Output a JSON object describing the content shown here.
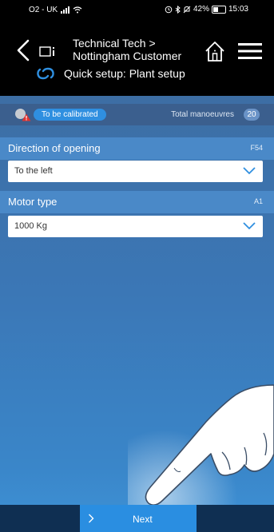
{
  "status": {
    "carrier": "O2 - UK",
    "battery": "42%",
    "time": "15:03"
  },
  "header": {
    "breadcrumb_line1": "Technical Tech >",
    "breadcrumb_line2": "Nottingham Customer",
    "setup_title": "Quick setup: Plant setup"
  },
  "calibration": {
    "status_label": "To be calibrated",
    "total_label": "Total manoeuvres",
    "total_value": "20"
  },
  "fields": {
    "direction": {
      "label": "Direction of opening",
      "code": "F54",
      "value": "To the left"
    },
    "motor": {
      "label": "Motor type",
      "code": "A1",
      "value": "1000 Kg"
    }
  },
  "footer": {
    "next_label": "Next"
  },
  "colors": {
    "accent": "#2a8ee1",
    "panel": "#3b77b6",
    "header_bg": "#000000"
  }
}
